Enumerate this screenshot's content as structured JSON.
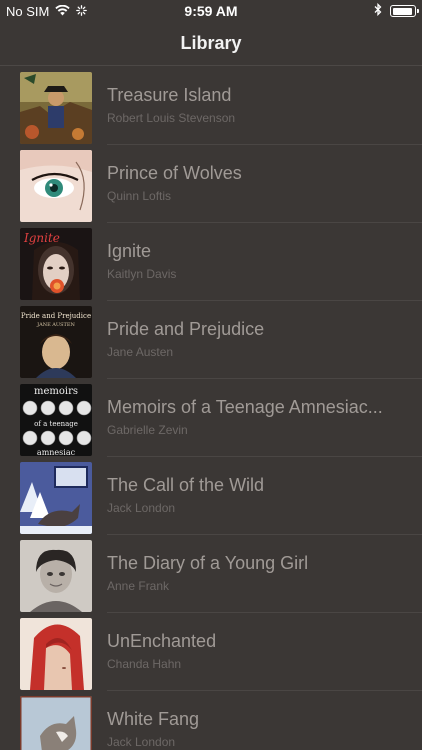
{
  "status_bar": {
    "carrier": "No SIM",
    "time": "9:59 AM",
    "battery_level": 0.95
  },
  "nav": {
    "title": "Library"
  },
  "books": [
    {
      "title": "Treasure Island",
      "author": "Robert Louis Stevenson",
      "cover_icon": "treasure-island-cover"
    },
    {
      "title": "Prince of Wolves",
      "author": "Quinn Loftis",
      "cover_icon": "prince-of-wolves-cover"
    },
    {
      "title": "Ignite",
      "author": "Kaitlyn Davis",
      "cover_icon": "ignite-cover",
      "cover_text": "Ignite"
    },
    {
      "title": "Pride and Prejudice",
      "author": "Jane Austen",
      "cover_icon": "pride-and-prejudice-cover",
      "cover_text": "Pride and Prejudice",
      "cover_subtext": "JANE AUSTEN"
    },
    {
      "title": "Memoirs of a Teenage Amnesiac...",
      "author": "Gabrielle Zevin",
      "cover_icon": "memoirs-cover",
      "cover_text": "memoirs",
      "cover_subtext": "of a teenage",
      "cover_bottom": "amnesiac"
    },
    {
      "title": "The Call of the Wild",
      "author": "Jack London",
      "cover_icon": "call-of-the-wild-cover"
    },
    {
      "title": "The Diary of a Young Girl",
      "author": "Anne Frank",
      "cover_icon": "diary-cover"
    },
    {
      "title": "UnEnchanted",
      "author": "Chanda Hahn",
      "cover_icon": "unenchanted-cover"
    },
    {
      "title": "White Fang",
      "author": "Jack London",
      "cover_icon": "white-fang-cover"
    }
  ]
}
